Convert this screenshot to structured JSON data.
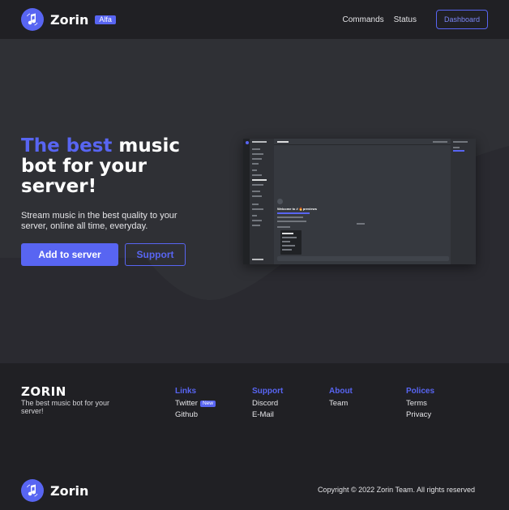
{
  "nav": {
    "brand": "Zorin",
    "badge": "Alfa",
    "links": [
      "Commands",
      "Status"
    ],
    "dashboard_label": "Dashboard"
  },
  "hero": {
    "title_accent": "The best",
    "title_rest": " music bot for your server!",
    "subtitle": "Stream music in the best quality to your server, online all time, everyday.",
    "primary_button": "Add to server",
    "secondary_button": "Support",
    "preview_welcome": "Welcome to # 🔥previews"
  },
  "footer": {
    "brand_title": "ZORIN",
    "brand_desc": "The best music bot for your server!",
    "columns": [
      {
        "title": "Links",
        "items": [
          {
            "label": "Twitter",
            "badge": "New"
          },
          {
            "label": "Github"
          }
        ]
      },
      {
        "title": "Support",
        "items": [
          {
            "label": "Discord"
          },
          {
            "label": "E-Mail"
          }
        ]
      },
      {
        "title": "About",
        "items": [
          {
            "label": "Team"
          }
        ]
      },
      {
        "title": "Polices",
        "items": [
          {
            "label": "Terms"
          },
          {
            "label": "Privacy"
          }
        ]
      }
    ],
    "bottom_brand": "Zorin",
    "copyright": "Copyright © 2022 Zorin Team. All rights reserved"
  },
  "icons": {
    "logo": "music-note-icon"
  },
  "colors": {
    "accent": "#5865f2",
    "nav_bg": "#202024",
    "hero_bg": "#2f3035",
    "footer_bg": "#202024"
  }
}
